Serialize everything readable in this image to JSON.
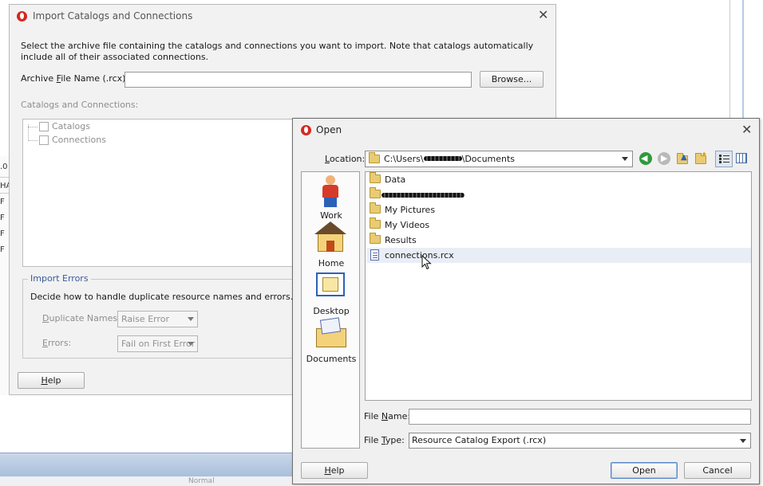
{
  "import_dialog": {
    "title": "Import Catalogs and Connections",
    "instructions": "Select the archive file containing the catalogs and connections you want to import.  Note that catalogs automatically include all of their associated connections.",
    "archive_label_pre": "Archive ",
    "archive_label_mnemonic": "F",
    "archive_label_post": "ile Name (.rcx):",
    "archive_value": "",
    "browse_label": "Browse...",
    "catalogs_connections_label": "Catalogs and Connections:",
    "tree_items": [
      "Catalogs",
      "Connections"
    ],
    "import_errors_legend": "Import Errors",
    "import_errors_desc": "Decide how to handle duplicate resource names and errors.",
    "duplicate_label_mnemonic": "D",
    "duplicate_label_rest": "uplicate Names:",
    "duplicate_value": "Raise Error",
    "errors_label_mnemonic": "E",
    "errors_label_rest": "rrors:",
    "errors_value": "Fail on First Error",
    "help_mnemonic": "H",
    "help_rest": "elp"
  },
  "open_dialog": {
    "title": "Open",
    "location_mnemonic": "L",
    "location_rest": "ocation:",
    "location_pre": "C:\\Users\\",
    "location_post": "\\Documents",
    "places": [
      "Work",
      "Home",
      "Desktop",
      "Documents"
    ],
    "files": [
      {
        "name": "Data",
        "type": "folder"
      },
      {
        "name": "",
        "type": "folder"
      },
      {
        "name": "My Pictures",
        "type": "folder"
      },
      {
        "name": "My Videos",
        "type": "folder"
      },
      {
        "name": "Results",
        "type": "folder"
      },
      {
        "name": "connections.rcx",
        "type": "file"
      }
    ],
    "filename_mnemonic": "N",
    "filename_pre": "File ",
    "filename_post": "ame:",
    "filename_value": "",
    "filetype_mnemonic": "T",
    "filetype_pre": "File ",
    "filetype_post": "ype:",
    "filetype_value": "Resource Catalog Export (.rcx)",
    "help_mnemonic": "H",
    "help_rest": "elp",
    "open_label": "Open",
    "cancel_label": "Cancel"
  },
  "background": {
    "ticks": [
      ".0",
      "HA",
      "F",
      "F",
      "F",
      "F"
    ],
    "toolbar_combo": "Normal"
  },
  "colors": {
    "accent_legend": "#3c5a9a",
    "app_icon": "#d6281f",
    "folder": "#e9cb73",
    "arrow_green": "#2e9a3c"
  }
}
